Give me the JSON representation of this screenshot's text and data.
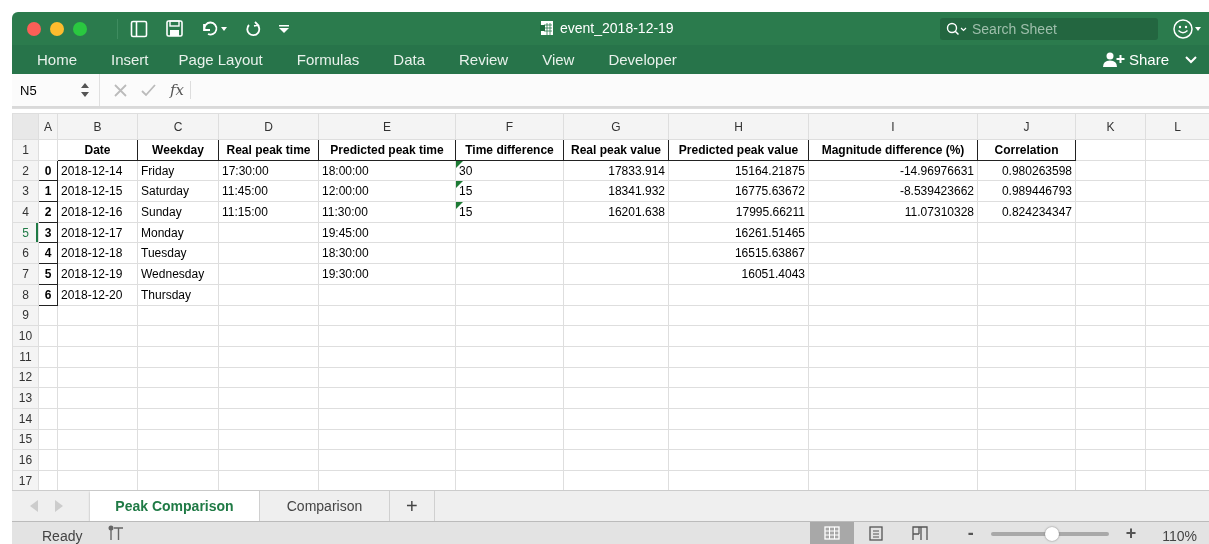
{
  "window": {
    "title": "event_2018-12-19"
  },
  "search": {
    "placeholder": "Search Sheet"
  },
  "ribbon_tabs": [
    "Home",
    "Insert",
    "Page Layout",
    "Formulas",
    "Data",
    "Review",
    "View",
    "Developer"
  ],
  "share_button": "Share",
  "name_box": "N5",
  "formula_label": "fx",
  "column_headers": [
    "A",
    "B",
    "C",
    "D",
    "E",
    "F",
    "G",
    "H",
    "I",
    "J",
    "K",
    "L"
  ],
  "rows": [
    {
      "number": "1",
      "kind": "header",
      "selected": false,
      "flag": false,
      "cells": [
        null,
        "Date",
        "Weekday",
        "Real peak time",
        "Predicted peak time",
        "Time difference",
        "Real peak value",
        "Predicted peak value",
        "Magnitude difference (%)",
        "Correlation"
      ]
    },
    {
      "number": "2",
      "kind": "data",
      "selected": false,
      "flag": true,
      "cells": [
        "0",
        "2018-12-14",
        "Friday",
        "17:30:00",
        "18:00:00",
        "30",
        "17833.914",
        "15164.21875",
        "-14.96976631",
        "0.980263598"
      ]
    },
    {
      "number": "3",
      "kind": "data",
      "selected": false,
      "flag": true,
      "cells": [
        "1",
        "2018-12-15",
        "Saturday",
        "11:45:00",
        "12:00:00",
        "15",
        "18341.932",
        "16775.63672",
        "-8.539423662",
        "0.989446793"
      ]
    },
    {
      "number": "4",
      "kind": "data",
      "selected": false,
      "flag": true,
      "cells": [
        "2",
        "2018-12-16",
        "Sunday",
        "11:15:00",
        "11:30:00",
        "15",
        "16201.638",
        "17995.66211",
        "11.07310328",
        "0.824234347"
      ]
    },
    {
      "number": "5",
      "kind": "data",
      "selected": true,
      "flag": false,
      "cells": [
        "3",
        "2018-12-17",
        "Monday",
        null,
        "19:45:00",
        null,
        null,
        "16261.51465",
        null,
        null
      ]
    },
    {
      "number": "6",
      "kind": "data",
      "selected": false,
      "flag": false,
      "cells": [
        "4",
        "2018-12-18",
        "Tuesday",
        null,
        "18:30:00",
        null,
        null,
        "16515.63867",
        null,
        null
      ]
    },
    {
      "number": "7",
      "kind": "data",
      "selected": false,
      "flag": false,
      "cells": [
        "5",
        "2018-12-19",
        "Wednesday",
        null,
        "19:30:00",
        null,
        null,
        "16051.4043",
        null,
        null
      ]
    },
    {
      "number": "8",
      "kind": "data",
      "selected": false,
      "flag": false,
      "cells": [
        "6",
        "2018-12-20",
        "Thursday",
        null,
        null,
        null,
        null,
        null,
        null,
        null
      ]
    },
    {
      "number": "9",
      "kind": "blank",
      "selected": false,
      "flag": false
    },
    {
      "number": "10",
      "kind": "blank",
      "selected": false,
      "flag": false
    },
    {
      "number": "11",
      "kind": "blank",
      "selected": false,
      "flag": false
    },
    {
      "number": "12",
      "kind": "blank",
      "selected": false,
      "flag": false
    },
    {
      "number": "13",
      "kind": "blank",
      "selected": false,
      "flag": false
    },
    {
      "number": "14",
      "kind": "blank",
      "selected": false,
      "flag": false
    },
    {
      "number": "15",
      "kind": "blank",
      "selected": false,
      "flag": false
    },
    {
      "number": "16",
      "kind": "blank",
      "selected": false,
      "flag": false
    },
    {
      "number": "17",
      "kind": "blank",
      "selected": false,
      "flag": false
    }
  ],
  "sheet_tabs": [
    {
      "label": "Peak Comparison",
      "selected": true
    },
    {
      "label": "Comparison",
      "selected": false
    }
  ],
  "add_sheet": "+",
  "status_bar": {
    "status": "Ready",
    "views": [
      {
        "kind": "normal",
        "selected": true
      },
      {
        "kind": "page",
        "selected": false
      },
      {
        "kind": "break",
        "selected": false
      }
    ],
    "zoom_minus": "-",
    "zoom_plus": "+",
    "zoom": {
      "level": 0.52
    },
    "zoom_label": "110%"
  }
}
